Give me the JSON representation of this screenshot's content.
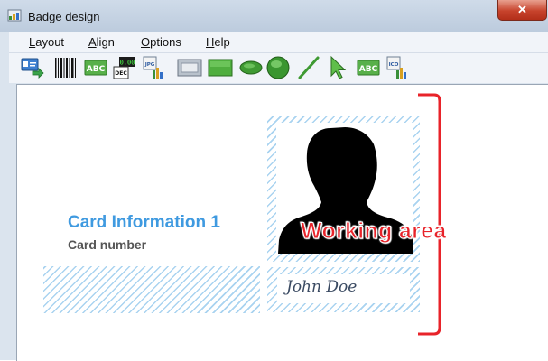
{
  "window": {
    "title": "Badge design",
    "close_glyph": "✕"
  },
  "menu": [
    {
      "label": "Layout",
      "accel": "L",
      "rest": "ayout"
    },
    {
      "label": "Align",
      "accel": "A",
      "rest": "lign"
    },
    {
      "label": "Options",
      "accel": "O",
      "rest": "ptions"
    },
    {
      "label": "Help",
      "accel": "H",
      "rest": "elp"
    }
  ],
  "toolbar": {
    "icons": [
      "card-select-icon",
      "barcode-icon",
      "text-abc-icon",
      "counter-dec-icon",
      "image-jpg-icon",
      "frame-icon",
      "rectangle-icon",
      "ellipse-icon",
      "circle-icon",
      "line-icon",
      "pointer-icon",
      "text-abc-icon",
      "image-ico-icon"
    ],
    "counter_text": "0.00",
    "counter_sub": "DEC",
    "abc_text": "ABC",
    "jpg_text": "JPG",
    "ico_text": "ICO"
  },
  "card": {
    "title": "Card Information 1",
    "number_label": "Card number",
    "signature": "John  Doe"
  },
  "annotation": {
    "label": "Working area",
    "color": "#e8232a"
  },
  "colors": {
    "accent_blue": "#3f9ae0",
    "hatch": "#a9d3f0"
  }
}
